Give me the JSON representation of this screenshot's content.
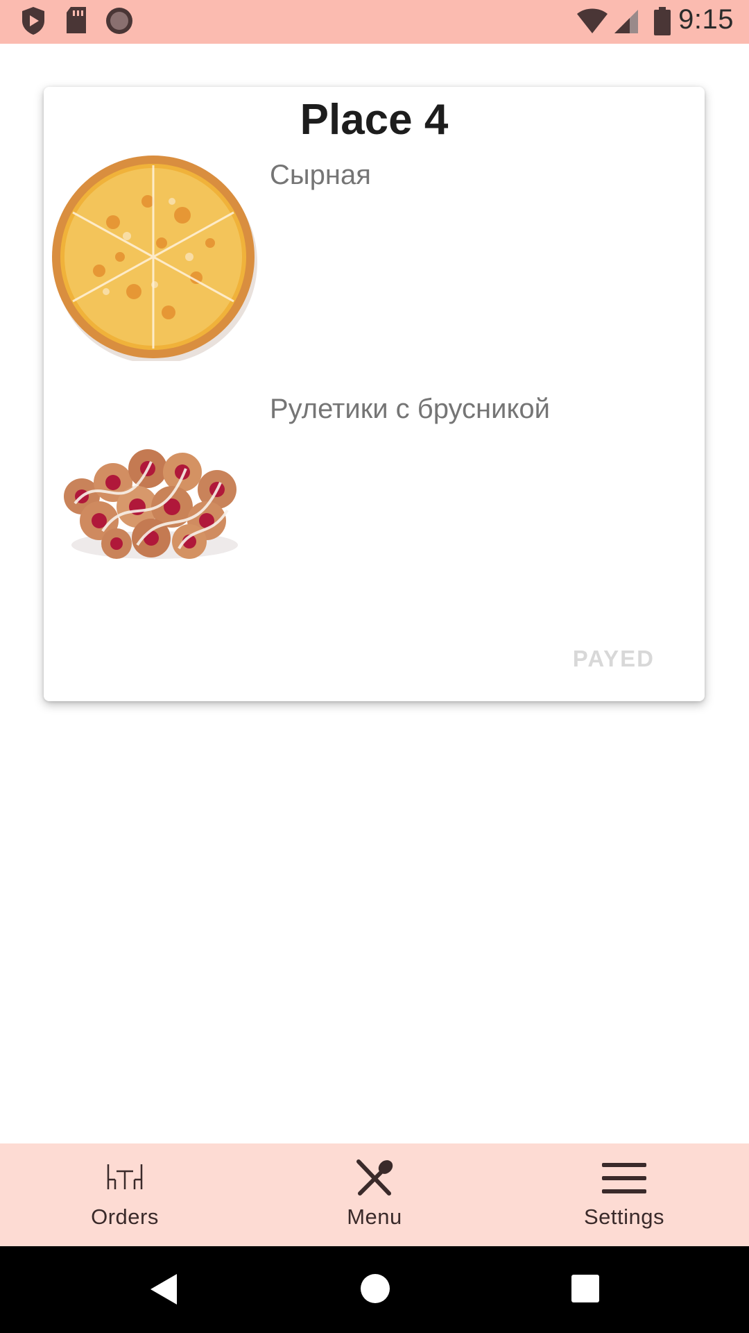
{
  "status_bar": {
    "time": "9:15",
    "left_icons": [
      "play-protect-icon",
      "sd-card-icon",
      "record-icon"
    ],
    "right_icons": [
      "wifi-icon",
      "signal-icon",
      "battery-icon"
    ],
    "background": "#fbbbb0"
  },
  "order": {
    "title": "Place 4",
    "items": [
      {
        "name": "Сырная",
        "image": "cheese-pizza-image"
      },
      {
        "name": "Рулетики с брусникой",
        "image": "lingonberry-rolls-image"
      }
    ],
    "payed_label": "PAYED"
  },
  "bottom_nav": {
    "background": "#fddbd3",
    "items": [
      {
        "label": "Orders",
        "icon": "table-chairs-icon"
      },
      {
        "label": "Menu",
        "icon": "fork-knife-icon"
      },
      {
        "label": "Settings",
        "icon": "hamburger-menu-icon"
      }
    ]
  },
  "system_nav": {
    "buttons": [
      "back-icon",
      "home-icon",
      "recents-icon"
    ]
  }
}
